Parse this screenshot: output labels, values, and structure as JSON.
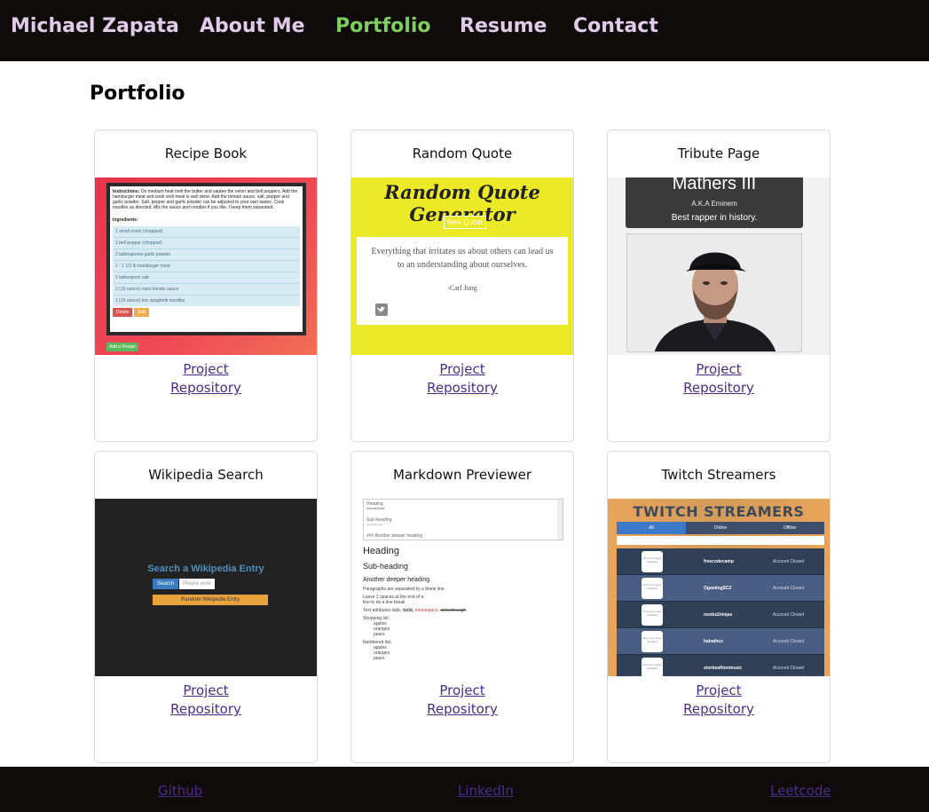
{
  "nav": {
    "brand": "Michael Zapata",
    "items": [
      {
        "label": "About Me",
        "active": false
      },
      {
        "label": "Portfolio",
        "active": true
      },
      {
        "label": "Resume",
        "active": false
      },
      {
        "label": "Contact",
        "active": false
      }
    ],
    "active_color": "#7dce5c",
    "text_color": "#e0cbe8"
  },
  "page_title": "Portfolio",
  "cards": [
    {
      "title": "Recipe Book",
      "project_label": "Project",
      "repo_label": "Repository",
      "thumb": {
        "instructions_label": "Instructions:",
        "instructions": "On medium heat melt the butter and sautee the onion and bell peppers. Add the hamburger meat and cook until meat is well done. Add the tomato sauce, salt, pepper and garlic powder. Salt, pepper and garlic powder can be adjusted to your own tastes. Cook noodles as directed. Mix the sauce and noodles if you like. I keep them separated.",
        "ingredients_label": "Ingredients:",
        "ingredients": [
          "1 small onion (chopped)",
          "1 bell pepper (chopped)",
          "2 tablespoons garlic powder",
          "1 - 1 1/2 lb hamburger meat",
          "1 tablespoon salt",
          "2 (15 ounce) cans tomato sauce",
          "1 (16 ounce) box spaghetti noodles"
        ],
        "delete_label": "Delete",
        "edit_label": "Edit",
        "add_label": "Add a Recipe"
      }
    },
    {
      "title": "Random Quote",
      "project_label": "Project",
      "repo_label": "Repository",
      "thumb": {
        "heading": "Random Quote Generator",
        "button": "New Quote",
        "quote": "Everything that irritates us about others can lead us to an understanding about ourselves.",
        "author": "-Carl Jung"
      }
    },
    {
      "title": "Tribute Page",
      "project_label": "Project",
      "repo_label": "Repository",
      "thumb": {
        "heading": "Mathers III",
        "aka": "A.K.A Eminem",
        "tagline": "Best rapper in history."
      }
    },
    {
      "title": "Wikipedia Search",
      "project_label": "Project",
      "repo_label": "Repository",
      "thumb": {
        "heading": "Search a Wikipedia Entry",
        "search_button": "Search",
        "placeholder": "Please ente",
        "random_button": "Random Wikipedia Entry"
      }
    },
    {
      "title": "Markdown Previewer",
      "project_label": "Project",
      "repo_label": "Repository",
      "thumb": {
        "editor_lines": [
          "Heading",
          "=======",
          "",
          "Sub-heading",
          "-----------",
          "",
          "### Another deeper heading"
        ],
        "h1": "Heading",
        "h2": "Sub-heading",
        "h3": "Another deeper heading",
        "p1": "Paragraphs are separated by a blank line.",
        "p2": "Leave 2 spaces at the end of a line to do a line break",
        "p3_prefix": "Text attributes italic,",
        "p3_bold": "bold,",
        "p3_mono": "monospace,",
        "p3_strike": "strikethrough",
        "list1_label": "Shopping list:",
        "list1": [
          "apples",
          "oranges",
          "pears"
        ],
        "list2_label": "Numbered list:",
        "list2": [
          "apples",
          "oranges",
          "pears"
        ]
      }
    },
    {
      "title": "Twitch Streamers",
      "project_label": "Project",
      "repo_label": "Repository",
      "thumb": {
        "heading": "TWITCH STREAMERS",
        "tabs": [
          "All",
          "Online",
          "Offline"
        ],
        "logo_text": "Sorry No Image Available",
        "rows": [
          {
            "name": "freecodecamp",
            "status": "Account Closed"
          },
          {
            "name": "OgamingSC2",
            "status": "Account Closed"
          },
          {
            "name": "noobs2ninjas",
            "status": "Account Closed"
          },
          {
            "name": "habathcx",
            "status": "Account Closed"
          },
          {
            "name": "storbeaftionmusic",
            "status": "Account Closed"
          }
        ]
      }
    }
  ],
  "footer": {
    "links": [
      "Github",
      "LinkedIn",
      "Leetcode"
    ]
  }
}
